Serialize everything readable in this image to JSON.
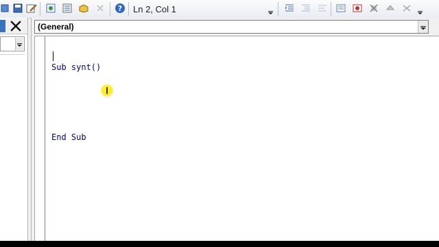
{
  "toolbar": {
    "position_label": "Ln 2, Col 1",
    "icons": [
      "toggle-folders-icon",
      "project-explorer-icon",
      "properties-icon",
      "object-browser-icon",
      "toolbox-icon",
      "help-icon",
      "indent-icon",
      "outdent-icon",
      "complete-word-icon",
      "toggle-breakpoint-icon",
      "comment-block-icon",
      "bookmark-icon"
    ]
  },
  "left_pane": {
    "close_glyph": "✕"
  },
  "code_window": {
    "object_combo_value": "(General)",
    "lines": [
      "Sub synt()",
      "",
      "End Sub"
    ]
  },
  "colors": {
    "keyword": "#00008b",
    "cursor_highlight": "#fff200",
    "selection_blue": "#3873c0"
  }
}
